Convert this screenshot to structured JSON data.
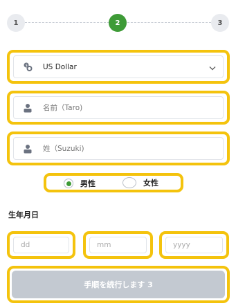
{
  "stepper": {
    "steps": [
      "1",
      "2",
      "3"
    ],
    "active_step": "2"
  },
  "currency": {
    "selected": "US Dollar",
    "icon": "coins-icon"
  },
  "first_name": {
    "placeholder": "名前（Taro)",
    "icon": "user-icon"
  },
  "last_name": {
    "placeholder": "姓（Suzuki)",
    "icon": "user-icon"
  },
  "gender": {
    "options": [
      "男性",
      "女性"
    ],
    "selected": "男性"
  },
  "dob": {
    "title": "生年月日",
    "day_placeholder": "dd",
    "month_placeholder": "mm",
    "year_placeholder": "yyyy"
  },
  "submit": {
    "label": "手順を続行します 3"
  },
  "colors": {
    "accent": "#3e9b37",
    "highlight": "#f4c30d",
    "disabled_button": "#c3c9d1"
  }
}
